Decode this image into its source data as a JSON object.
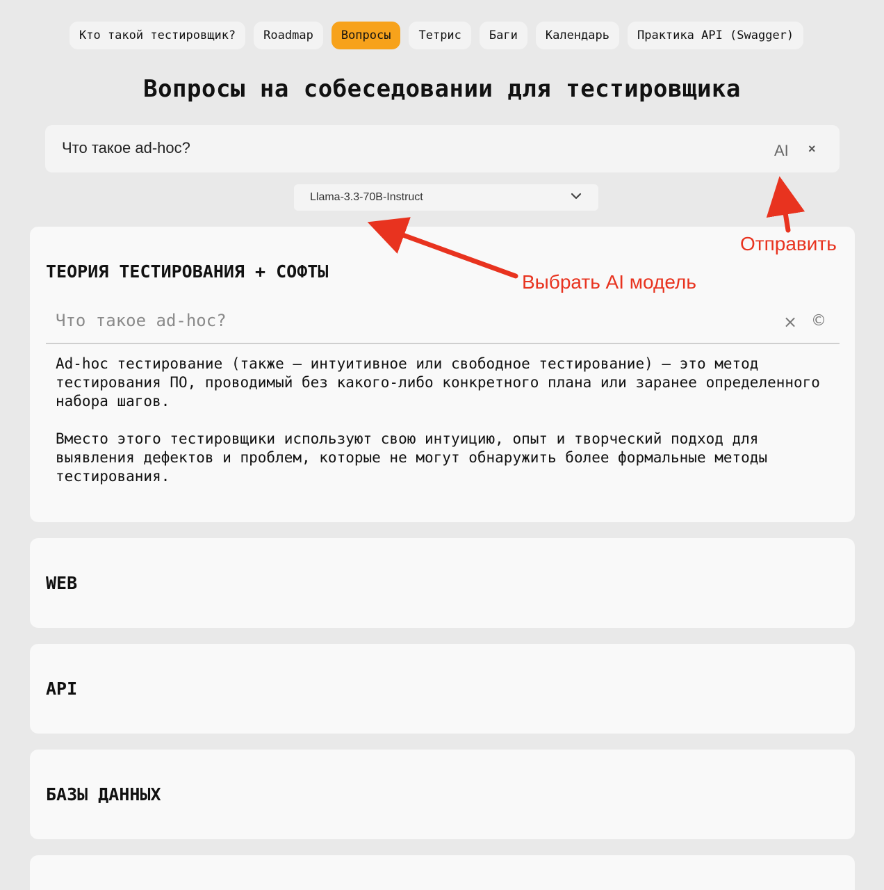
{
  "nav": {
    "items": [
      {
        "label": "Кто такой тестировщик?",
        "active": false
      },
      {
        "label": "Roadmap",
        "active": false
      },
      {
        "label": "Вопросы",
        "active": true
      },
      {
        "label": "Тетрис",
        "active": false
      },
      {
        "label": "Баги",
        "active": false
      },
      {
        "label": "Календарь",
        "active": false
      },
      {
        "label": "Практика API (Swagger)",
        "active": false
      }
    ],
    "active_color": "#f7a21b"
  },
  "page_title": "Вопросы на собеседовании для тестировщика",
  "ai_search": {
    "value": "Что такое ad-hoc?",
    "send_label": "AI",
    "close_label": "×"
  },
  "model_select": {
    "selected": "Llama-3.3-70B-Instruct",
    "icon": "chevron-down-icon"
  },
  "sections": [
    {
      "title": "ТЕОРИЯ ТЕСТИРОВАНИЯ + СОФТЫ",
      "question": "Что такое ad-hoc?",
      "clear_label": "×",
      "copy_label": "©",
      "answer": [
        "Ad-hoc тестирование (также — интуитивное или свободное тестирование) — это метод тестирования ПО, проводимый без какого-либо конкретного плана или заранее определенного набора шагов.",
        "Вместо этого тестировщики используют свою интуицию, опыт и творческий подход для выявления дефектов и проблем, которые не могут обнаружить более формальные методы тестирования."
      ]
    },
    {
      "title": "WEB"
    },
    {
      "title": "API"
    },
    {
      "title": "БАЗЫ ДАННЫХ"
    }
  ],
  "annotations": {
    "send": "Отправить",
    "choose_model": "Выбрать AI модель",
    "color": "#e8331f"
  }
}
